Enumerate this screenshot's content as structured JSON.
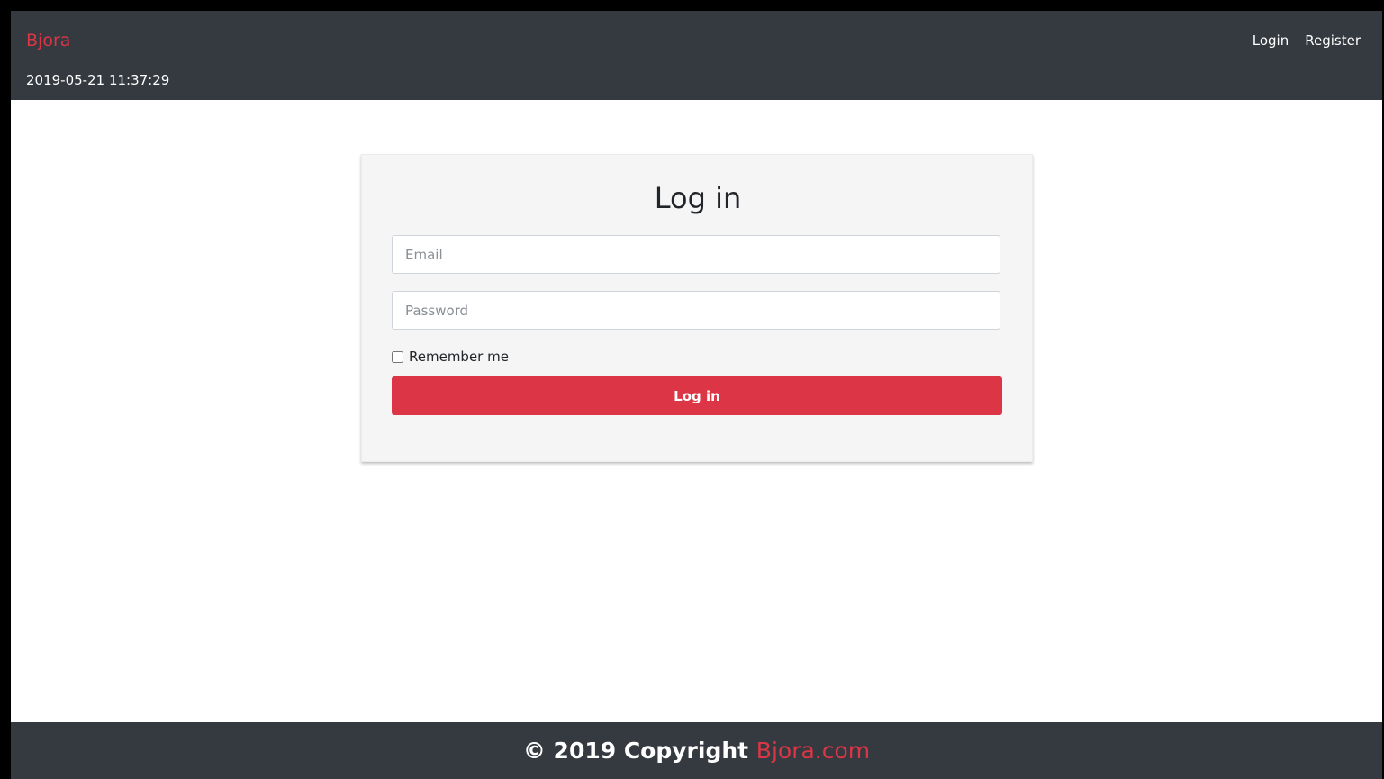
{
  "navbar": {
    "brand": "Bjora",
    "datetime": "2019-05-21 11:37:29",
    "links": [
      "Login",
      "Register"
    ]
  },
  "login_form": {
    "title": "Log in",
    "email_placeholder": "Email",
    "password_placeholder": "Password",
    "remember_label": "Remember me",
    "remember_checked": false,
    "submit_label": "Log in"
  },
  "footer": {
    "copyright": "© 2019 Copyright",
    "site_link": "Bjora.com"
  },
  "colors": {
    "accent": "#dc3545",
    "navbar_bg": "#343a40",
    "card_bg": "#f5f5f5"
  }
}
